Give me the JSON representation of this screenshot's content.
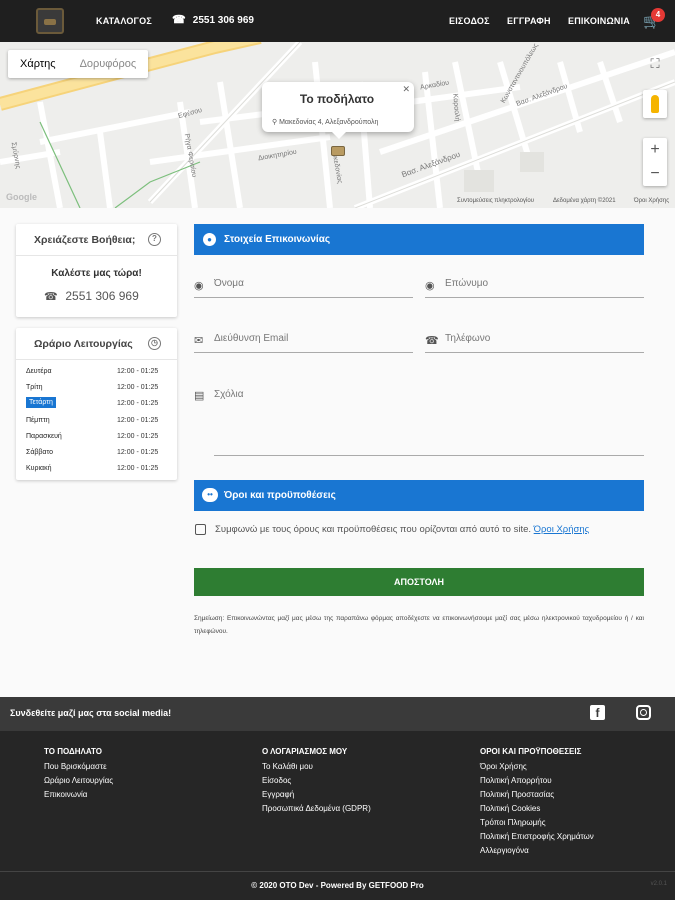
{
  "header": {
    "nav": [
      "ΚΑΤΑΛΟΓΟΣ",
      "ΕΙΣΟΔΟΣ",
      "ΕΓΓΡΑΦΗ",
      "ΕΠΙΚΟΙΝΩΝΙΑ"
    ],
    "phone": "2551 306 969",
    "cart_count": "4"
  },
  "map": {
    "toggle": [
      "Χάρτης",
      "Δορυφόρος"
    ],
    "info_title": "Το ποδήλατο",
    "info_address": "Μακεδονίας 4, Αλεξανδρούπολη",
    "labels": [
      "Βασ. Αλεξάνδρου",
      "Βασ. Αλεξάνδρου",
      "Εφέσου",
      "Αρκαδίου",
      "Διοικητηρίου",
      "Ρήγα Φεραίου",
      "Μακεδονίας",
      "Καραολή",
      "Σμύρνης",
      "Κωνσταντινουπόλεως"
    ],
    "footer_links": [
      "Συντομεύσεις πληκτρολογίου",
      "Δεδομένα χάρτη ©2021",
      "Όροι Χρήσης"
    ],
    "google": "Google"
  },
  "help": {
    "title": "Χρειάζεστε Βοήθεια;",
    "subtitle": "Καλέστε μας τώρα!",
    "phone": "2551 306 969"
  },
  "hours": {
    "title": "Ωράριο Λειτουργίας",
    "rows": [
      {
        "day": "Δευτέρα",
        "time": "12:00 - 01:25"
      },
      {
        "day": "Τρίτη",
        "time": "12:00 - 01:25"
      },
      {
        "day": "Τετάρτη",
        "time": "12:00 - 01:25"
      },
      {
        "day": "Πέμπτη",
        "time": "12:00 - 01:25"
      },
      {
        "day": "Παρασκευή",
        "time": "12:00 - 01:25"
      },
      {
        "day": "Σάββατο",
        "time": "12:00 - 01:25"
      },
      {
        "day": "Κυριακή",
        "time": "12:00 - 01:25"
      }
    ]
  },
  "contact": {
    "title": "Στοιχεία Επικοινωνίας",
    "first_name_placeholder": "Όνομα",
    "last_name_placeholder": "Επώνυμο",
    "email_placeholder": "Διεύθυνση Email",
    "phone_placeholder": "Τηλέφωνο",
    "comments_placeholder": "Σχόλια"
  },
  "terms": {
    "title": "Όροι και προϋποθέσεις",
    "agree_text": "Συμφωνώ με τους όρους και προϋποθέσεις που ορίζονται από αυτό το site. ",
    "terms_link": "Όροι Χρήσης"
  },
  "submit_label": "ΑΠΟΣΤΟΛΗ",
  "note": "Σημείωση: Επικοινωνώντας μαζί μας μέσω της παραπάνω φόρμας αποδέχεστε να επικοινωνήσουμε μαζί σας μέσω ηλεκτρονικού ταχυδρομείου ή / και τηλεφώνου.",
  "social": {
    "text": "Συνδεθείτε μαζί μας στα social media!"
  },
  "footer": {
    "col1": {
      "title": "ΤΟ ΠΟΔΗΛΑΤΟ",
      "links": [
        "Που Βρισκόμαστε",
        "Ωράριο Λειτουργίας",
        "Επικοινωνία"
      ]
    },
    "col2": {
      "title": "Ο ΛΟΓΑΡΙΑΣΜΟΣ ΜΟΥ",
      "links": [
        "Το Καλάθι μου",
        "Είσοδος",
        "Εγγραφή",
        "Προσωπικά Δεδομένα (GDPR)"
      ]
    },
    "col3": {
      "title": "ΟΡΟΙ ΚΑΙ ΠΡΟΫΠΟΘΕΣΕΙΣ",
      "links": [
        "Όροι Χρήσης",
        "Πολιτική Απορρήτου",
        "Πολιτική Προστασίας",
        "Πολιτική Cookies",
        "Τρόποι Πληρωμής",
        "Πολιτική Επιστροφής Χρημάτων",
        "Αλλεργιογόνα"
      ]
    },
    "copyright": "© 2020 OTO Dev - Powered By GETFOOD Pro",
    "version": "v2.0.1"
  }
}
